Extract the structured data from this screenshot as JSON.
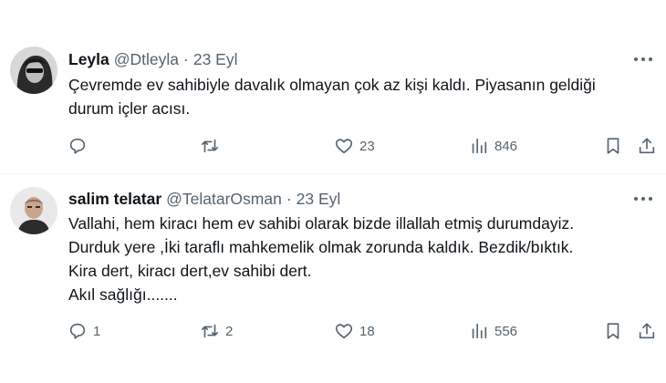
{
  "tweets": [
    {
      "name": "Leyla",
      "handle": "@Dtleyla",
      "dot": "·",
      "date": "23 Eyl",
      "text_lines": [
        "Çevremde ev sahibiyle davalık olmayan çok az kişi kaldı. Piyasanın geldiği",
        "durum içler acısı."
      ],
      "replies": "",
      "retweets": "",
      "likes": "23",
      "views": "846"
    },
    {
      "name": "salim telatar",
      "handle": "@TelatarOsman",
      "dot": "·",
      "date": "23 Eyl",
      "text_lines": [
        "Vallahi,  hem kiracı hem ev sahibi olarak bizde illallah etmiş durumdayiz.",
        "Durduk yere ,İki taraflı mahkemelik olmak zorunda kaldık. Bezdik/bıktık.",
        "Kira dert, kiracı dert,ev sahibi dert.",
        "Akıl sağlığı......."
      ],
      "replies": "1",
      "retweets": "2",
      "likes": "18",
      "views": "556"
    }
  ],
  "icons": {
    "reply": "reply-icon",
    "retweet": "retweet-icon",
    "like": "heart-icon",
    "views": "views-bar-chart-icon",
    "bookmark": "bookmark-icon",
    "share": "share-icon",
    "more": "more-dots-icon"
  },
  "colors": {
    "text": "#0f1419",
    "secondary": "#536471",
    "divider": "#eff3f4"
  }
}
